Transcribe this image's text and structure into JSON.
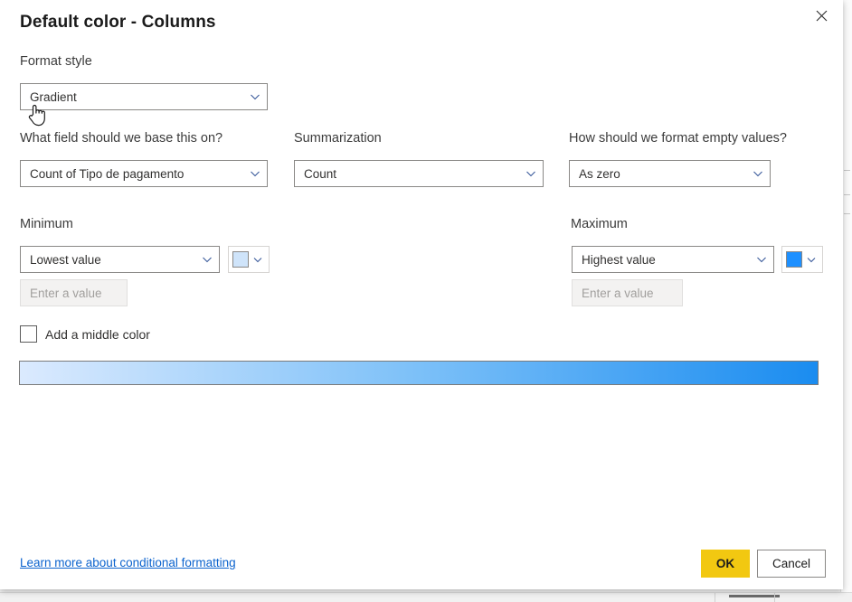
{
  "dialog": {
    "title": "Default color - Columns",
    "close_icon": "close-icon"
  },
  "format_style": {
    "label": "Format style",
    "value": "Gradient"
  },
  "base_field": {
    "label": "What field should we base this on?",
    "value": "Count of Tipo de pagamento"
  },
  "summarization": {
    "label": "Summarization",
    "value": "Count"
  },
  "empty_values": {
    "label": "How should we format empty values?",
    "value": "As zero"
  },
  "minimum": {
    "label": "Minimum",
    "value": "Lowest value",
    "input_placeholder": "Enter a value",
    "input_value": "",
    "color": "#cfe4fa"
  },
  "maximum": {
    "label": "Maximum",
    "value": "Highest value",
    "input_placeholder": "Enter a value",
    "input_value": "",
    "color": "#1e90ff"
  },
  "middle_color": {
    "label": "Add a middle color",
    "checked": false
  },
  "gradient_preview": {
    "start_color": "#dbeafe",
    "mid_color": "#7cc0f8",
    "end_color": "#1a8cf0"
  },
  "footer": {
    "learn_more_label": "Learn more about conditional formatting",
    "ok_label": "OK",
    "cancel_label": "Cancel"
  },
  "colors": {
    "accent_yellow": "#f2c811",
    "link_blue": "#0b63ce",
    "border_gray": "#8a8886"
  }
}
